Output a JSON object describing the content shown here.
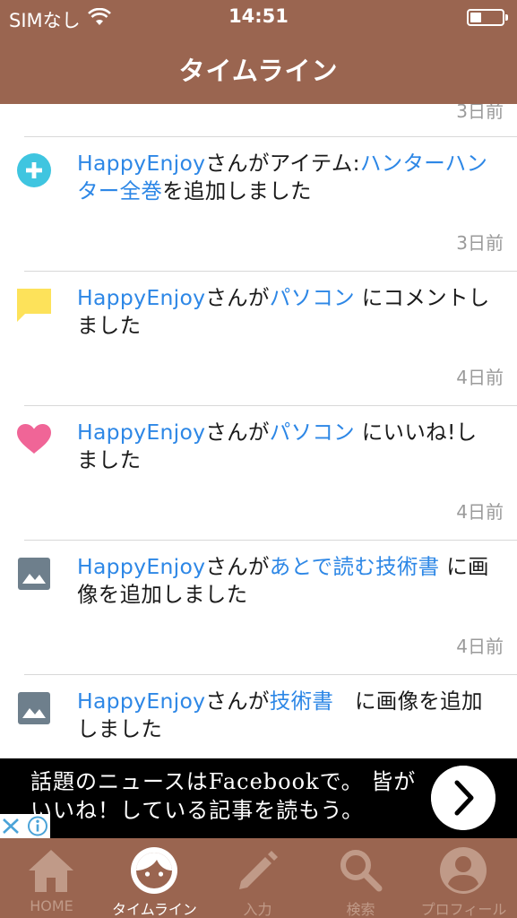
{
  "status_bar": {
    "carrier": "SIMなし",
    "time": "14:51"
  },
  "nav": {
    "title": "タイムライン"
  },
  "timeline": {
    "top_time": "3日前",
    "items": [
      {
        "icon": "plus-circle-icon",
        "user": "HappyEnjoy",
        "t1": "さんがアイテム:",
        "target": "ハンターハンター全巻",
        "t2": "を追加しました",
        "time": "3日前"
      },
      {
        "icon": "comment-icon",
        "user": "HappyEnjoy",
        "t1": "さんが",
        "target": "パソコン",
        "t2": " にコメントしました",
        "time": "4日前"
      },
      {
        "icon": "heart-icon",
        "user": "HappyEnjoy",
        "t1": "さんが",
        "target": "パソコン",
        "t2": " にいいね!しました",
        "time": "4日前"
      },
      {
        "icon": "image-icon",
        "user": "HappyEnjoy",
        "t1": "さんが",
        "target": "あとで読む技術書",
        "t2": " に画像を追加しました",
        "time": "4日前"
      },
      {
        "icon": "image-icon",
        "user": "HappyEnjoy",
        "t1": "さんが",
        "target": "技術書",
        "t2": "　に画像を追加しました",
        "time": ""
      }
    ]
  },
  "ad": {
    "line1": "話題のニュースはFacebookで。 皆が",
    "line2": "いいね！している記事を読もう。"
  },
  "tabs": [
    {
      "label": "HOME",
      "icon": "home-icon",
      "active": false
    },
    {
      "label": "タイムライン",
      "icon": "face-icon",
      "active": true
    },
    {
      "label": "入力",
      "icon": "pencil-icon",
      "active": false
    },
    {
      "label": "検索",
      "icon": "search-icon",
      "active": false
    },
    {
      "label": "プロフィール",
      "icon": "person-icon",
      "active": false
    }
  ],
  "colors": {
    "header": "#9a6550",
    "link": "#2d87e6",
    "add_icon": "#3fc5e0",
    "comment_icon": "#fde25a",
    "heart_icon": "#f06597",
    "image_icon": "#6e7f8c"
  }
}
